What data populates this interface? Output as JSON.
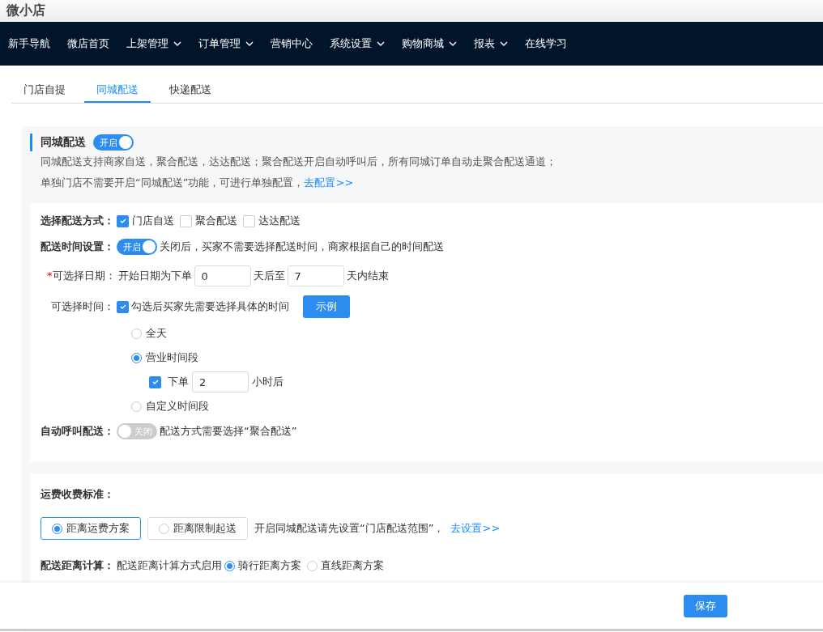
{
  "app_title": "微小店",
  "nav": [
    {
      "label": "新手导航",
      "dropdown": false
    },
    {
      "label": "微店首页",
      "dropdown": false
    },
    {
      "label": "上架管理",
      "dropdown": true
    },
    {
      "label": "订单管理",
      "dropdown": true
    },
    {
      "label": "营销中心",
      "dropdown": false
    },
    {
      "label": "系统设置",
      "dropdown": true
    },
    {
      "label": "购物商城",
      "dropdown": true
    },
    {
      "label": "报表",
      "dropdown": true
    },
    {
      "label": "在线学习",
      "dropdown": false
    }
  ],
  "tabs": [
    {
      "label": "门店自提",
      "selected": false
    },
    {
      "label": "同城配送",
      "selected": true
    },
    {
      "label": "快递配送",
      "selected": false
    }
  ],
  "section": {
    "title": "同城配送",
    "switch": {
      "on": true,
      "label": "开启"
    },
    "line_1": "同城配送支持商家自送，聚合配送，达达配送；聚合配送开启自动呼叫后，所有同城订单自动走聚合配送通道；",
    "line_2": "单独门店不需要开启“同城配送”功能，可进行单独配置，",
    "link": "去配置>>"
  },
  "delivery_methods": {
    "label": "选择配送方式：",
    "options": [
      {
        "label": "门店自送",
        "checked": true
      },
      {
        "label": "聚合配送",
        "checked": false
      },
      {
        "label": "达达配送",
        "checked": false
      }
    ]
  },
  "time_setting": {
    "label": "配送时间设置：",
    "switch": {
      "on": true,
      "label": "开启"
    },
    "hint": "关闭后，买家不需要选择配送时间，商家根据自己的时间配送"
  },
  "date": {
    "required": "*",
    "label": "可选择日期：",
    "prefix": "开始日期为下单",
    "start": "0",
    "middle": "天后至",
    "end": "7",
    "suffix": "天内结束"
  },
  "time": {
    "label": "可选择时间：",
    "checked": true,
    "text": "勾选后买家先需要选择具体的时间",
    "example_button": "示例",
    "options": [
      {
        "label": "全天",
        "selected": false
      },
      {
        "label": "营业时间段",
        "selected": true,
        "sub": {
          "checked": true,
          "prefix": "下单",
          "value": "2",
          "suffix": "小时后"
        }
      },
      {
        "label": "自定义时间段",
        "selected": false
      }
    ]
  },
  "auto_call": {
    "label": "自动呼叫配送：",
    "switch": {
      "on": false,
      "label": "关闭"
    },
    "hint": "配送方式需要选择“聚合配送”"
  },
  "fee": {
    "label": "运费收费标准：",
    "options": [
      {
        "label": "距离运费方案",
        "selected": true
      },
      {
        "label": "距离限制起送",
        "selected": false
      }
    ],
    "hint": "开启同城配送请先设置“门店配送范围”，",
    "link": "去设置>>"
  },
  "distance": {
    "label": "配送距离计算：",
    "hint": "配送距离计算方式启用",
    "options": [
      {
        "label": "骑行距离方案",
        "selected": true
      },
      {
        "label": "直线距离方案",
        "selected": false
      }
    ]
  },
  "save_button": "保存"
}
